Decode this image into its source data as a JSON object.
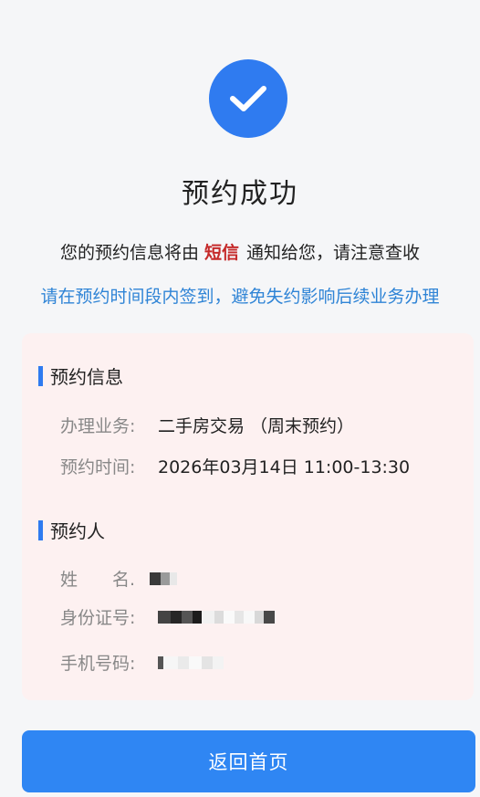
{
  "result": {
    "title": "预约成功",
    "notice_before": "您的预约信息将由",
    "notice_channel": "短信",
    "notice_after": "通知给您，请注意查收",
    "tip": "请在预约时间段内签到，避免失约影响后续业务办理",
    "icon": "check-circle-icon",
    "accent_color": "#2f7bf0",
    "highlight_color": "#c52a2a",
    "tip_color": "#2f84d6"
  },
  "booking_info": {
    "section_title": "预约信息",
    "service_label": "办理业务:",
    "service_value": "二手房交易 （周末预约）",
    "time_label": "预约时间:",
    "time_value": "2026年03月14日 11:00-13:30"
  },
  "applicant": {
    "section_title": "预约人",
    "name_label": "姓　　名.",
    "id_label": "身份证号:",
    "phone_label": "手机号码:"
  },
  "actions": {
    "return_label": "返回首页"
  }
}
